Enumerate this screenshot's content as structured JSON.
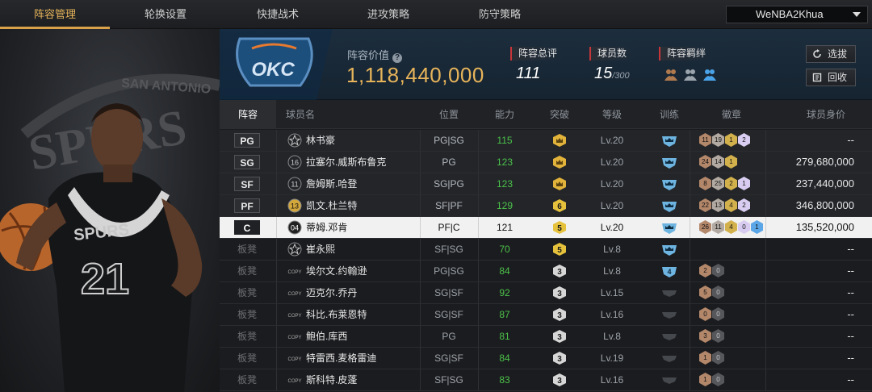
{
  "nav": {
    "tabs": [
      "阵容管理",
      "轮换设置",
      "快捷战术",
      "进攻策略",
      "防守策略"
    ],
    "active_index": 0,
    "account": "WeNBA2Khua"
  },
  "team": {
    "logo_text": "OKC",
    "value_label": "阵容价值",
    "value": "1,118,440,000",
    "rating_label": "阵容总评",
    "rating": "111",
    "players_label": "球员数",
    "players_count": "15",
    "players_max": "/300",
    "bond_label": "阵容羁绊",
    "select_button": "选拔",
    "recycle_button": "回收"
  },
  "columns": [
    "阵容",
    "球员名",
    "位置",
    "能力",
    "突破",
    "等级",
    "训练",
    "徽章",
    "球员身价"
  ],
  "players": [
    {
      "slot": "PG",
      "jersey": "☆",
      "name": "林书豪",
      "position": "PG|SG",
      "ability": "115",
      "break": "",
      "level": "Lv.20",
      "train": "",
      "badges": [
        "11",
        "19",
        "1",
        "2"
      ],
      "worth": "--",
      "type": "starter"
    },
    {
      "slot": "SG",
      "jersey": "16",
      "name": "拉塞尔.威斯布鲁克",
      "position": "PG",
      "ability": "123",
      "break": "",
      "level": "Lv.20",
      "train": "",
      "badges": [
        "24",
        "14",
        "1"
      ],
      "worth": "279,680,000",
      "type": "starter"
    },
    {
      "slot": "SF",
      "jersey": "11",
      "name": "詹姆斯.哈登",
      "position": "SG|PG",
      "ability": "123",
      "break": "",
      "level": "Lv.20",
      "train": "",
      "badges": [
        "8",
        "25",
        "2",
        "1"
      ],
      "worth": "237,440,000",
      "type": "starter"
    },
    {
      "slot": "PF",
      "jersey": "13",
      "name": "凯文.杜兰特",
      "position": "SF|PF",
      "ability": "129",
      "break": "6",
      "level": "Lv.20",
      "train": "",
      "badges": [
        "22",
        "13",
        "4",
        "2"
      ],
      "worth": "346,800,000",
      "type": "starter"
    },
    {
      "slot": "C",
      "jersey": "04",
      "name": "蒂姆.邓肯",
      "position": "PF|C",
      "ability": "121",
      "break": "5",
      "level": "Lv.20",
      "train": "",
      "badges": [
        "26",
        "11",
        "4",
        "0",
        "1"
      ],
      "worth": "135,520,000",
      "type": "selected"
    },
    {
      "slot": "板凳",
      "jersey": "☆",
      "name": "崔永熙",
      "position": "SF|SG",
      "ability": "70",
      "break": "5",
      "level": "Lv.8",
      "train": "",
      "badges": [],
      "worth": "--",
      "type": "bench"
    },
    {
      "slot": "板凳",
      "jersey": "COPY",
      "name": "埃尔文.约翰逊",
      "position": "PG|SG",
      "ability": "84",
      "break": "3",
      "level": "Lv.8",
      "train": "4",
      "badges": [
        "2",
        "0"
      ],
      "worth": "--",
      "type": "bench"
    },
    {
      "slot": "板凳",
      "jersey": "COPY",
      "name": "迈克尔.乔丹",
      "position": "SG|SF",
      "ability": "92",
      "break": "3",
      "level": "Lv.15",
      "train": "",
      "badges": [
        "5",
        "0"
      ],
      "worth": "--",
      "type": "bench"
    },
    {
      "slot": "板凳",
      "jersey": "COPY",
      "name": "科比.布莱恩特",
      "position": "SG|SF",
      "ability": "87",
      "break": "3",
      "level": "Lv.16",
      "train": "",
      "badges": [
        "0",
        "0"
      ],
      "worth": "--",
      "type": "bench"
    },
    {
      "slot": "板凳",
      "jersey": "COPY",
      "name": "鲍伯.库西",
      "position": "PG",
      "ability": "81",
      "break": "3",
      "level": "Lv.8",
      "train": "",
      "badges": [
        "3",
        "0"
      ],
      "worth": "--",
      "type": "bench"
    },
    {
      "slot": "板凳",
      "jersey": "COPY",
      "name": "特雷西.麦格雷迪",
      "position": "SG|SF",
      "ability": "84",
      "break": "3",
      "level": "Lv.19",
      "train": "",
      "badges": [
        "1",
        "0"
      ],
      "worth": "--",
      "type": "bench"
    },
    {
      "slot": "板凳",
      "jersey": "COPY",
      "name": "斯科特.皮蓬",
      "position": "SF|SG",
      "ability": "83",
      "break": "3",
      "level": "Lv.16",
      "train": "",
      "badges": [
        "1",
        "0"
      ],
      "worth": "--",
      "type": "bench"
    }
  ],
  "art": {
    "logo_text": "SPURS",
    "logo_sub": "SAN ANTONIO",
    "jersey_team": "SPURS",
    "jersey_number": "21"
  },
  "colors": {
    "accent": "#d9a24a",
    "value": "#e7b45a",
    "ability": "#4cc14a",
    "stat_marker": "#c8353a"
  }
}
